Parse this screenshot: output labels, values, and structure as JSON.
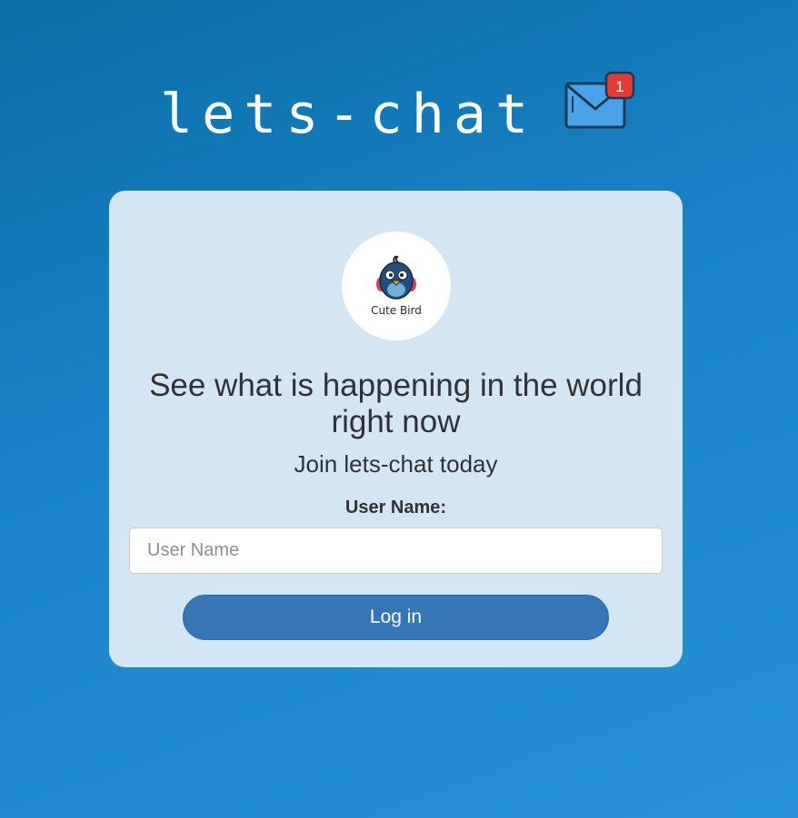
{
  "brand": {
    "title": "lets-chat",
    "notification_count": "1"
  },
  "card": {
    "logo_label": "Cute Bird",
    "headline": "See what is happening in the world right now",
    "subline": "Join lets-chat today",
    "username_label": "User Name:",
    "username_placeholder": "User Name",
    "username_value": "",
    "login_label": "Log in"
  },
  "colors": {
    "background_top": "#0a6fa8",
    "background_bottom": "#2790d8",
    "card": "#d4e6f3",
    "button": "#3577b6",
    "badge": "#e53935"
  }
}
